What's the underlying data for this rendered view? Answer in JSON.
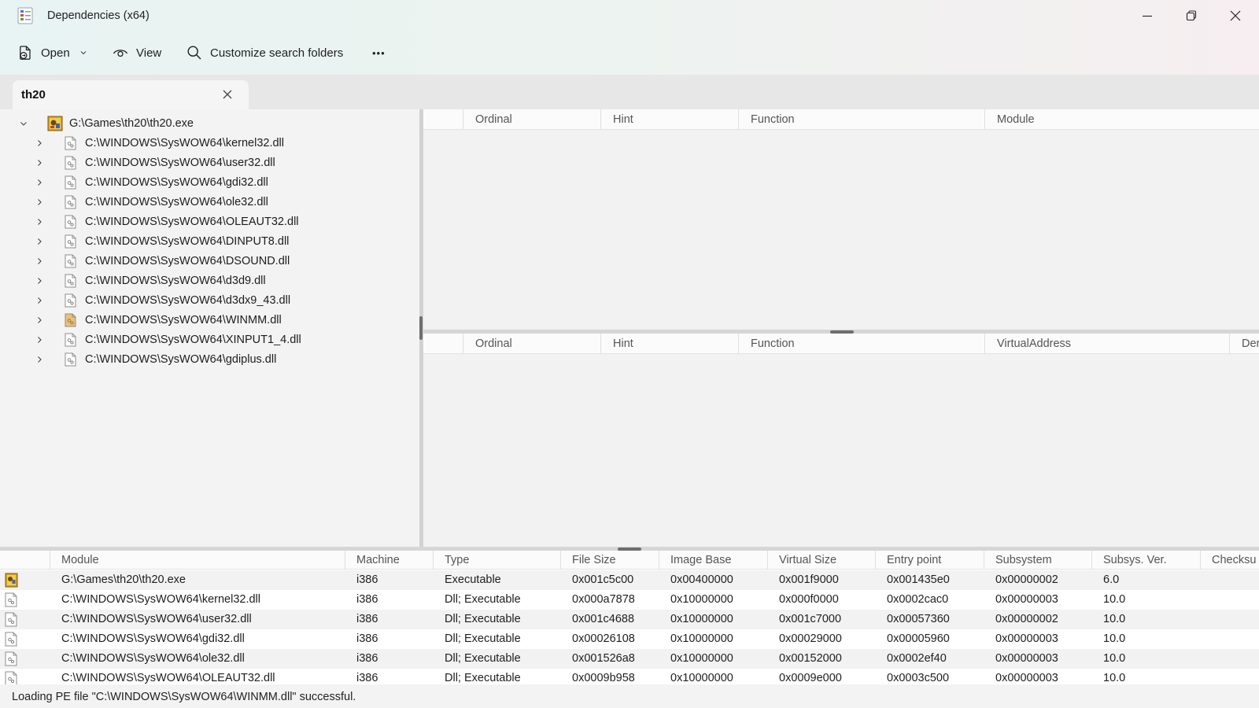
{
  "window": {
    "title": "Dependencies (x64)"
  },
  "toolbar": {
    "open_label": "Open",
    "view_label": "View",
    "customize_label": "Customize search folders",
    "more_label": "•••"
  },
  "tab": {
    "label": "th20"
  },
  "tree": {
    "root": {
      "label": "G:\\Games\\th20\\th20.exe",
      "icon": "game-exe-icon"
    },
    "children": [
      {
        "label": "C:\\WINDOWS\\SysWOW64\\kernel32.dll",
        "icon": "dll-file-icon"
      },
      {
        "label": "C:\\WINDOWS\\SysWOW64\\user32.dll",
        "icon": "dll-file-icon"
      },
      {
        "label": "C:\\WINDOWS\\SysWOW64\\gdi32.dll",
        "icon": "dll-file-icon"
      },
      {
        "label": "C:\\WINDOWS\\SysWOW64\\ole32.dll",
        "icon": "dll-file-icon"
      },
      {
        "label": "C:\\WINDOWS\\SysWOW64\\OLEAUT32.dll",
        "icon": "dll-file-icon"
      },
      {
        "label": "C:\\WINDOWS\\SysWOW64\\DINPUT8.dll",
        "icon": "dll-file-icon"
      },
      {
        "label": "C:\\WINDOWS\\SysWOW64\\DSOUND.dll",
        "icon": "dll-file-icon"
      },
      {
        "label": "C:\\WINDOWS\\SysWOW64\\d3d9.dll",
        "icon": "dll-file-icon"
      },
      {
        "label": "C:\\WINDOWS\\SysWOW64\\d3dx9_43.dll",
        "icon": "dll-file-icon"
      },
      {
        "label": "C:\\WINDOWS\\SysWOW64\\WINMM.dll",
        "icon": "dll-file-highlighted-icon"
      },
      {
        "label": "C:\\WINDOWS\\SysWOW64\\XINPUT1_4.dll",
        "icon": "dll-file-icon"
      },
      {
        "label": "C:\\WINDOWS\\SysWOW64\\gdiplus.dll",
        "icon": "dll-file-icon"
      }
    ]
  },
  "imports": {
    "columns": [
      "Ordinal",
      "Hint",
      "Function",
      "Module"
    ]
  },
  "exports": {
    "columns": [
      "Ordinal",
      "Hint",
      "Function",
      "VirtualAddress",
      "Der"
    ]
  },
  "modules": {
    "columns": [
      "Module",
      "Machine",
      "Type",
      "File Size",
      "Image Base",
      "Virtual Size",
      "Entry point",
      "Subsystem",
      "Subsys. Ver.",
      "Checksu"
    ],
    "rows": [
      {
        "icon": "game-exe-icon",
        "cells": [
          "G:\\Games\\th20\\th20.exe",
          "i386",
          "Executable",
          "0x001c5c00",
          "0x00400000",
          "0x001f9000",
          "0x001435e0",
          "0x00000002",
          "6.0"
        ]
      },
      {
        "icon": "dll-file-icon",
        "cells": [
          "C:\\WINDOWS\\SysWOW64\\kernel32.dll",
          "i386",
          "Dll; Executable",
          "0x000a7878",
          "0x10000000",
          "0x000f0000",
          "0x0002cac0",
          "0x00000003",
          "10.0"
        ]
      },
      {
        "icon": "dll-file-icon",
        "cells": [
          "C:\\WINDOWS\\SysWOW64\\user32.dll",
          "i386",
          "Dll; Executable",
          "0x001c4688",
          "0x10000000",
          "0x001c7000",
          "0x00057360",
          "0x00000002",
          "10.0"
        ]
      },
      {
        "icon": "dll-file-icon",
        "cells": [
          "C:\\WINDOWS\\SysWOW64\\gdi32.dll",
          "i386",
          "Dll; Executable",
          "0x00026108",
          "0x10000000",
          "0x00029000",
          "0x00005960",
          "0x00000003",
          "10.0"
        ]
      },
      {
        "icon": "dll-file-icon",
        "cells": [
          "C:\\WINDOWS\\SysWOW64\\ole32.dll",
          "i386",
          "Dll; Executable",
          "0x001526a8",
          "0x10000000",
          "0x00152000",
          "0x0002ef40",
          "0x00000003",
          "10.0"
        ]
      },
      {
        "icon": "dll-file-icon",
        "cells": [
          "C:\\WINDOWS\\SysWOW64\\OLEAUT32.dll",
          "i386",
          "Dll; Executable",
          "0x0009b958",
          "0x10000000",
          "0x0009e000",
          "0x0003c500",
          "0x00000003",
          "10.0"
        ]
      }
    ]
  },
  "status": {
    "text": "Loading PE file \"C:\\WINDOWS\\SysWOW64\\WINMM.dll\" successful."
  }
}
